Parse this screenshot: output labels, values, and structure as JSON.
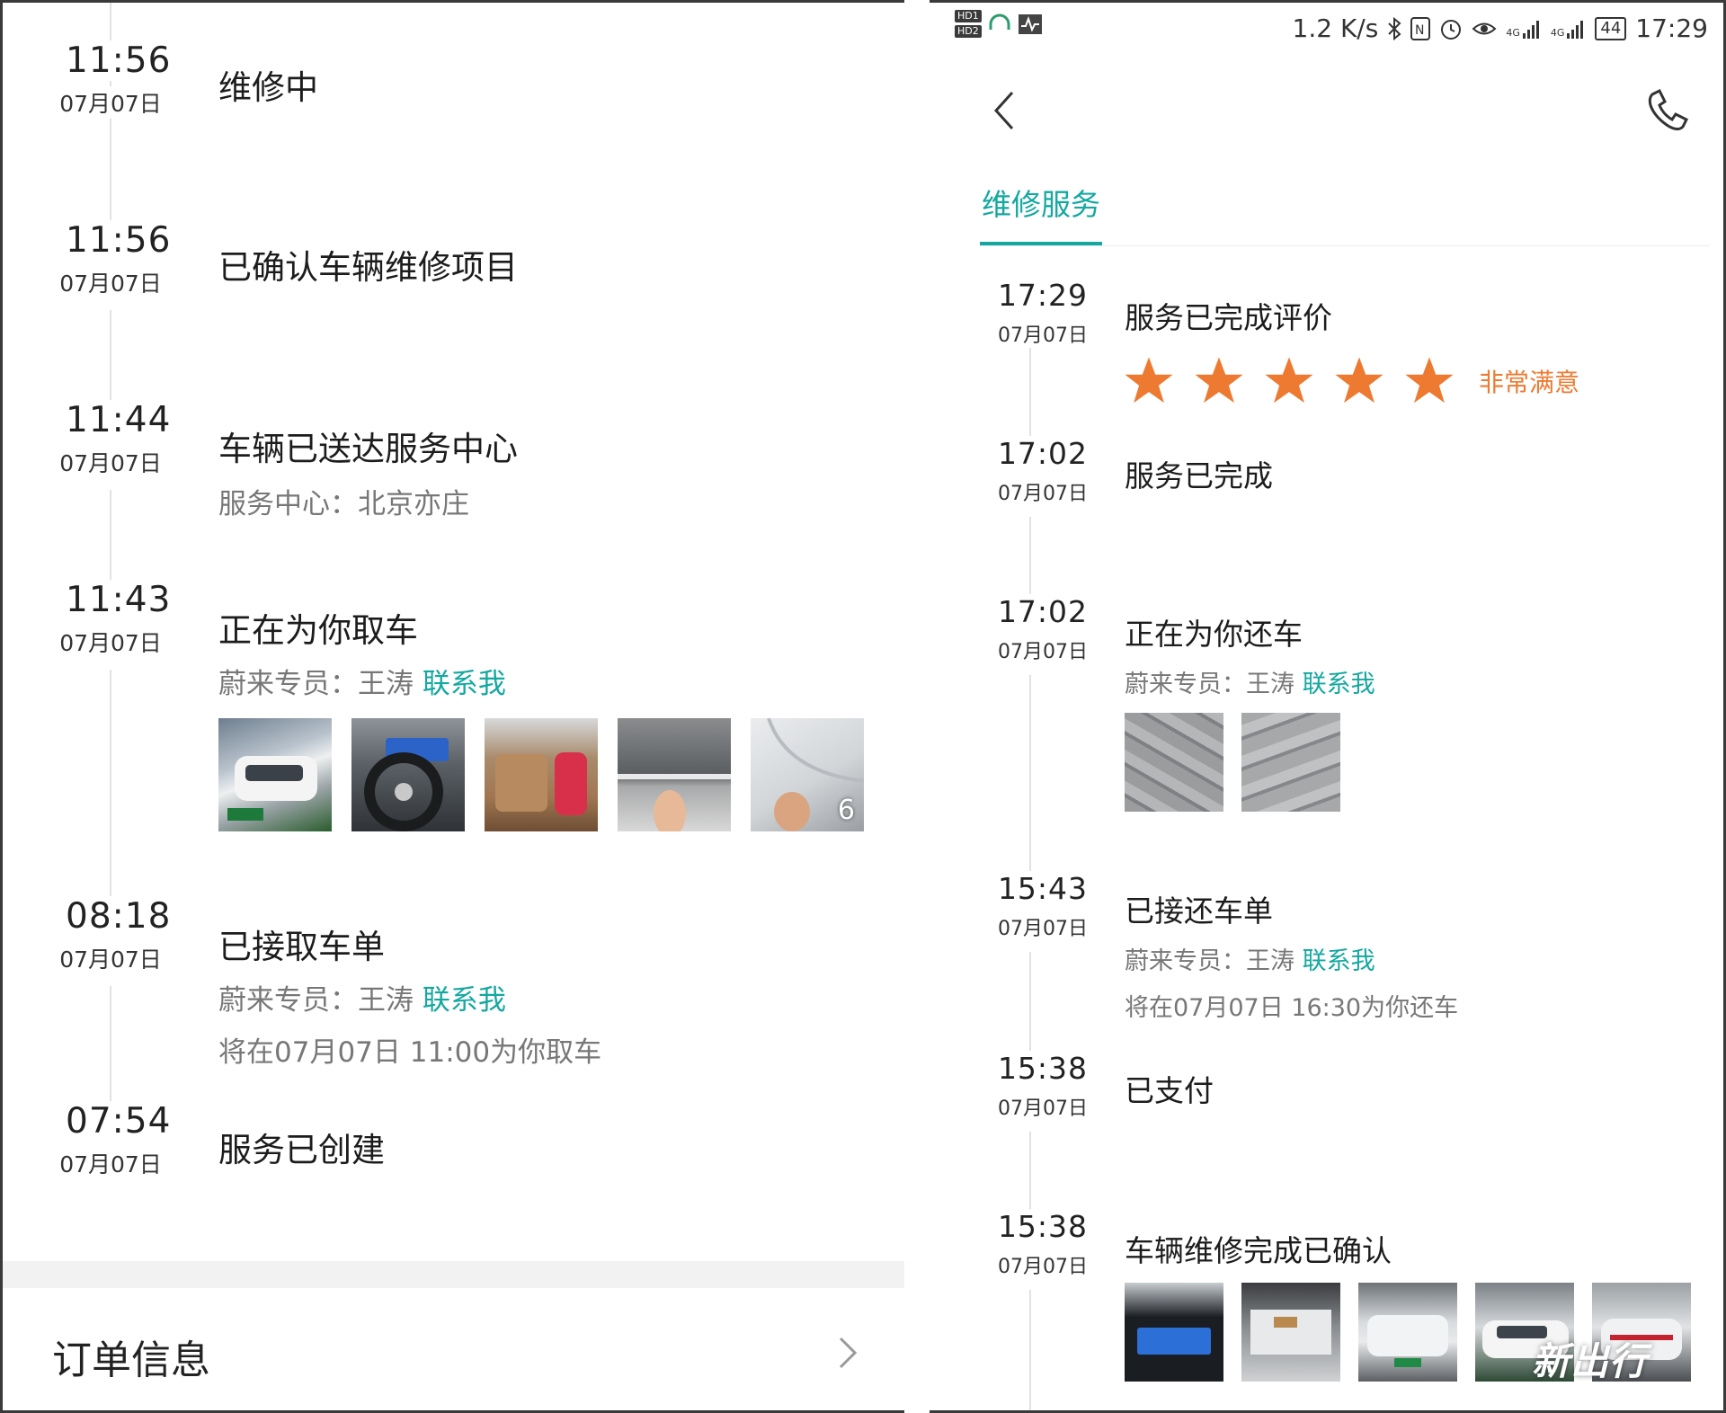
{
  "left": {
    "timeline": [
      {
        "time": "11:56",
        "date": "07月07日",
        "title": "维修中"
      },
      {
        "time": "11:56",
        "date": "07月07日",
        "title": "已确认车辆维修项目"
      },
      {
        "time": "11:44",
        "date": "07月07日",
        "title": "车辆已送达服务中心",
        "sub": "服务中心：北京亦庄"
      },
      {
        "time": "11:43",
        "date": "07月07日",
        "title": "正在为你取车",
        "staff": "蔚来专员：王涛",
        "link": "联系我",
        "photo_more_count": "6"
      },
      {
        "time": "08:18",
        "date": "07月07日",
        "title": "已接取车单",
        "staff": "蔚来专员：王涛",
        "link": "联系我",
        "note": "将在07月07日 11:00为你取车"
      },
      {
        "time": "07:54",
        "date": "07月07日",
        "title": "服务已创建"
      }
    ],
    "order_info_label": "订单信息"
  },
  "right": {
    "status_bar": {
      "hd1": "HD1",
      "hd2": "HD2",
      "speed": "1.2 K/s",
      "signal1": "4G",
      "signal2": "4G",
      "battery": "44",
      "time": "17:29"
    },
    "tab_label": "维修服务",
    "timeline": [
      {
        "time": "17:29",
        "date": "07月07日",
        "title": "服务已完成评价",
        "rating": 5,
        "rating_text": "非常满意"
      },
      {
        "time": "17:02",
        "date": "07月07日",
        "title": "服务已完成"
      },
      {
        "time": "17:02",
        "date": "07月07日",
        "title": "正在为你还车",
        "staff": "蔚来专员：王涛",
        "link": "联系我"
      },
      {
        "time": "15:43",
        "date": "07月07日",
        "title": "已接还车单",
        "staff": "蔚来专员：王涛",
        "link": "联系我",
        "note": "将在07月07日 16:30为你还车"
      },
      {
        "time": "15:38",
        "date": "07月07日",
        "title": "已支付"
      },
      {
        "time": "15:38",
        "date": "07月07日",
        "title": "车辆维修完成已确认"
      }
    ],
    "watermark": "新出行"
  },
  "colors": {
    "accent": "#14a8a1",
    "star": "#ee7a31",
    "timeline_line": "#e2e2e2"
  },
  "icons": {
    "back": "chevron-left-icon",
    "phone": "phone-icon",
    "order_chevron": "chevron-right-icon",
    "star": "star-icon"
  }
}
